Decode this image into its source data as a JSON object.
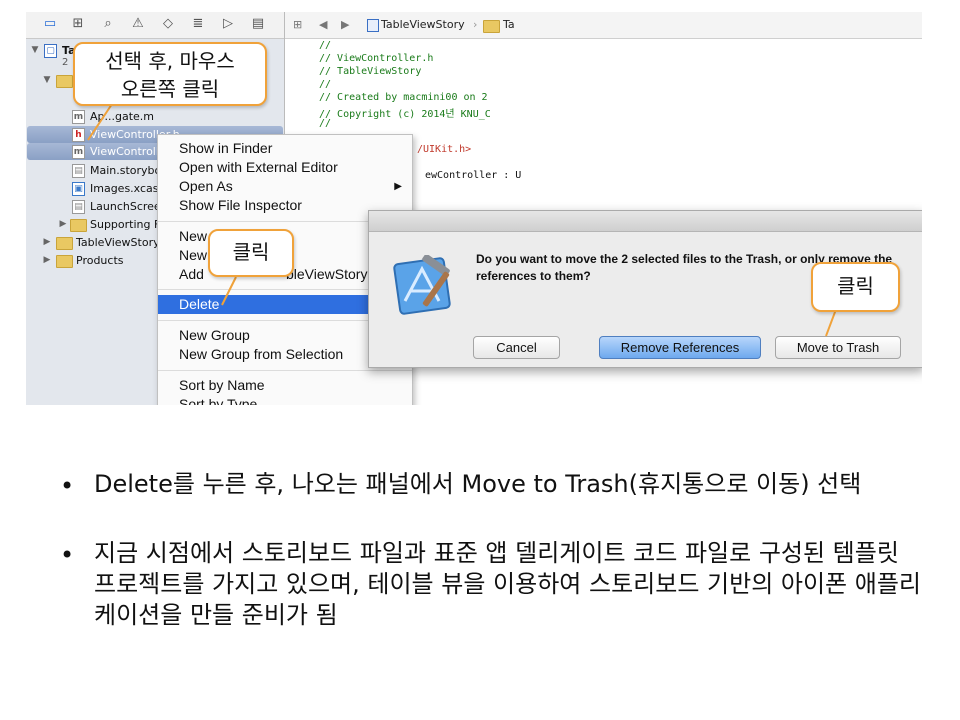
{
  "navigator": {
    "rows": [
      {
        "label": "Ta"
      },
      {
        "label": "2"
      },
      {
        "label": "ApplicationDelegate.m",
        "display": "Ap...gate.m"
      },
      {
        "label": "ViewController.h"
      },
      {
        "label": "ViewController.m",
        "display": "ViewControlle"
      },
      {
        "label": "Main.storybo"
      },
      {
        "label": "Images.xcass"
      },
      {
        "label": "LaunchScree"
      },
      {
        "label": "Supporting F"
      },
      {
        "label": "TableViewStory"
      },
      {
        "label": "Products"
      }
    ]
  },
  "editor": {
    "jump_bar": {
      "project": "TableViewStory",
      "next": "Ta"
    },
    "code_lines": [
      "//",
      "//  ViewController.h",
      "//  TableViewStory",
      "//",
      "//  Created by macmini00 on 2",
      "//  Copyright (c) 2014년 KNU_C",
      "//",
      "/UIKit.h>",
      "ewController : U"
    ]
  },
  "context_menu": {
    "items": [
      {
        "label": "Show in Finder"
      },
      {
        "label": "Open with External Editor"
      },
      {
        "label": "Open As",
        "submenu": true
      },
      {
        "label": "Show File Inspector"
      },
      {
        "label": "New"
      },
      {
        "label": "New"
      },
      {
        "label": "Add",
        "suffix": "bleViewStory"
      },
      {
        "label": "Delete",
        "highlighted": true
      },
      {
        "label": "New Group"
      },
      {
        "label": "New Group from Selection"
      },
      {
        "label": "Sort by Name"
      },
      {
        "label": "Sort by Type"
      }
    ]
  },
  "dialog": {
    "message": "Do you want to move the 2 selected files to the Trash, or only remove the references to them?",
    "buttons": {
      "cancel": "Cancel",
      "remove": "Remove References",
      "trash": "Move to Trash"
    }
  },
  "callouts": {
    "select_right_click": [
      "선택 후, 마우스",
      "오른쪽 클릭"
    ],
    "click_delete": "클릭",
    "click_trash": "클릭"
  },
  "bullets": [
    "Delete를 누른 후, 나오는 패널에서 Move to Trash(휴지통으로 이동) 선택",
    "지금 시점에서 스토리보드 파일과 표준 앱 델리게이트 코드 파일로 구성된 템플릿 프로젝트를 가지고 있으며, 테이블 뷰을 이용하여 스토리보드 기반의 아이폰 애플리케이션을 만들 준비가 됨"
  ],
  "colors": {
    "callout_border": "#f0a23a",
    "menu_highlight": "#2f6fe0",
    "comment_green": "#1a7b1a"
  }
}
